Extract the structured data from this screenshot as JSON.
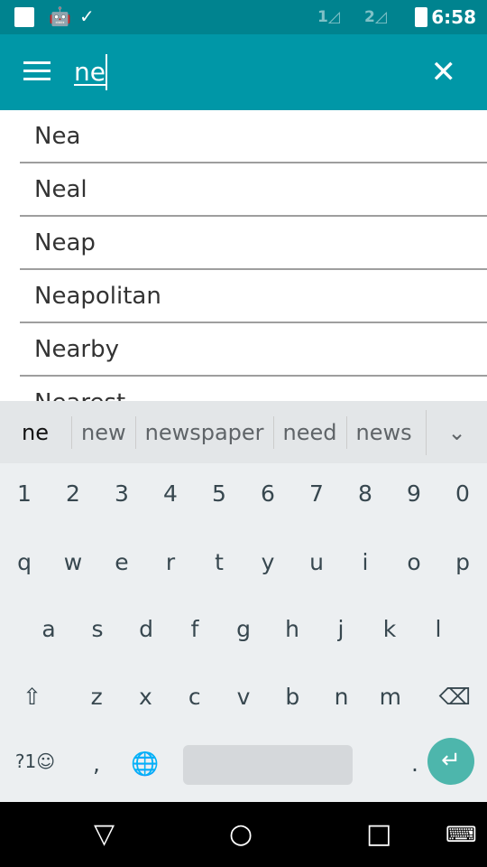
{
  "status": {
    "time": "6:58",
    "sim1": "1",
    "sim2": "2",
    "icons": [
      "square-icon",
      "android-debug-icon",
      "clipboard-check-icon",
      "signal-icon",
      "battery-charging-icon"
    ]
  },
  "toolbar": {
    "query": "ne",
    "menu_icon": "hamburger-icon",
    "close_icon": "close-icon"
  },
  "results": [
    "Nea",
    "Neal",
    "Neap",
    "Neapolitan",
    "Nearby",
    "Nearest"
  ],
  "keyboard": {
    "suggestions": [
      "ne",
      "new",
      "newspaper",
      "need",
      "news"
    ],
    "numbers": [
      "1",
      "2",
      "3",
      "4",
      "5",
      "6",
      "7",
      "8",
      "9",
      "0"
    ],
    "row1": [
      "q",
      "w",
      "e",
      "r",
      "t",
      "y",
      "u",
      "i",
      "o",
      "p"
    ],
    "row2": [
      "a",
      "s",
      "d",
      "f",
      "g",
      "h",
      "j",
      "k",
      "l"
    ],
    "row3": [
      "z",
      "x",
      "c",
      "v",
      "b",
      "n",
      "m"
    ],
    "symbols": "?1☺",
    "comma": ",",
    "period": "."
  },
  "colors": {
    "status": "#00838f",
    "toolbar": "#0097a7",
    "enter": "#4db6ac"
  }
}
